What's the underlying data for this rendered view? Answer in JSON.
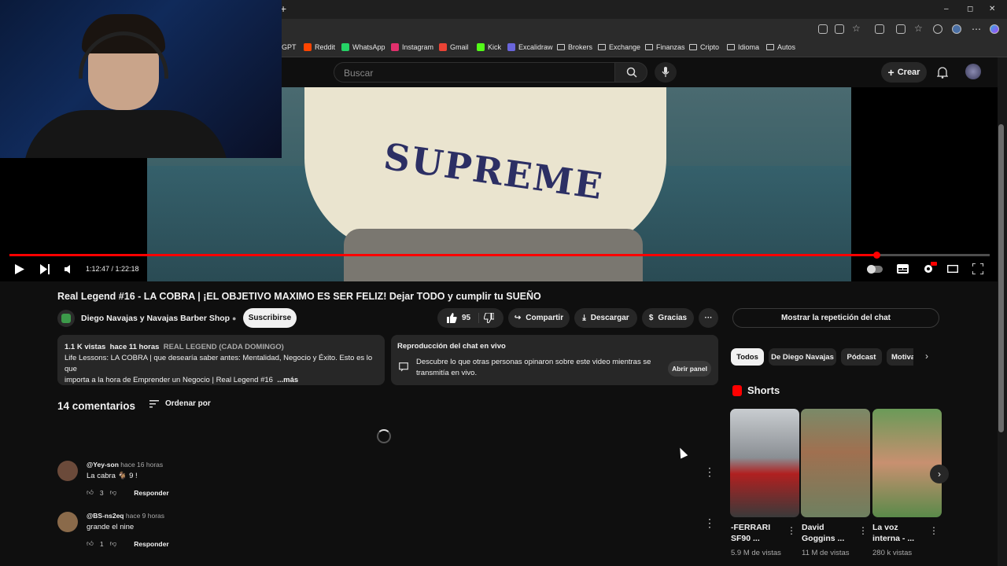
{
  "browser": {
    "new_tab": "+",
    "window_controls": [
      "–",
      "◻",
      "✕"
    ],
    "bookmarks": [
      {
        "label": "GPT",
        "color": "#10a37f"
      },
      {
        "label": "Reddit",
        "color": "#ff4500"
      },
      {
        "label": "WhatsApp",
        "color": "#25d366"
      },
      {
        "label": "Instagram",
        "color": "#e1306c"
      },
      {
        "label": "Gmail",
        "color": "#ea4335"
      },
      {
        "label": "Kick",
        "color": "#53fc18"
      },
      {
        "label": "Excalidraw",
        "color": "#6965db"
      },
      {
        "label": "Brokers",
        "color": "folder"
      },
      {
        "label": "Exchange",
        "color": "folder"
      },
      {
        "label": "Finanzas",
        "color": "folder"
      },
      {
        "label": "Cripto",
        "color": "folder"
      },
      {
        "label": "Idioma",
        "color": "folder"
      },
      {
        "label": "Autos",
        "color": "folder"
      }
    ]
  },
  "header": {
    "search_placeholder": "Buscar",
    "create_label": "Crear"
  },
  "player": {
    "overlay_text": "SUPREME",
    "time_current": "1:12:47",
    "time_total": "1:22:18",
    "time_display": "1:12:47 / 1:22:18",
    "progress": 0.8846
  },
  "video": {
    "title": "Real Legend #16 - LA COBRA | ¡EL OBJETIVO MAXIMO ES SER FELIZ! Dejar TODO y cumplir tu SUEÑO",
    "channel": "Diego Navajas y Navajas Barber Shop",
    "subscribe": "Suscribirse",
    "likes": "95",
    "share": "Compartir",
    "download": "Descargar",
    "thanks": "Gracias",
    "more": "···"
  },
  "description": {
    "views": "1.1 K vistas",
    "time": "hace 11 horas",
    "tag": "REAL LEGEND (CADA DOMINGO)",
    "line1": "Life Lessons: LA COBRA | que desearía saber antes: Mentalidad, Negocio y Éxito. Esto es lo que",
    "line2": "importa a la hora de Emprender un Negocio | Real Legend #16",
    "more": "...más"
  },
  "livechat": {
    "heading": "Reproducción del chat en vivo",
    "body": "Descubre lo que otras personas opinaron sobre este video mientras se transmitía en vivo.",
    "open_panel": "Abrir panel",
    "show_replay": "Mostrar la repetición del chat"
  },
  "comments": {
    "title": "14 comentarios",
    "sort": "Ordenar por",
    "reply_label": "Responder",
    "items": [
      {
        "author": "@Yey-son",
        "time": "hace 16 horas",
        "text": "La cabra 🐐 9 !",
        "likes": "3",
        "avatar_color": "#6b4a3a"
      },
      {
        "author": "@BS-ns2eq",
        "time": "hace 9 horas",
        "text": "grande el nine",
        "likes": "1",
        "avatar_color": "#8a6a4a"
      }
    ]
  },
  "chips": [
    "Todos",
    "De Diego Navajas",
    "Pódcast",
    "Motiva"
  ],
  "shorts": {
    "title": "Shorts",
    "items": [
      {
        "title": "-FERRARI SF90 ...",
        "views": "5.9 M de vistas",
        "color": "#8a8f94"
      },
      {
        "title": "David Goggins ...",
        "views": "11 M de vistas",
        "color": "#6e8060"
      },
      {
        "title": "La voz interna - ...",
        "views": "280 k vistas",
        "color": "#5a8a4a"
      }
    ]
  },
  "colors": {
    "accent": "#ff0000",
    "background": "#0f0f0f",
    "surface": "#272727"
  }
}
